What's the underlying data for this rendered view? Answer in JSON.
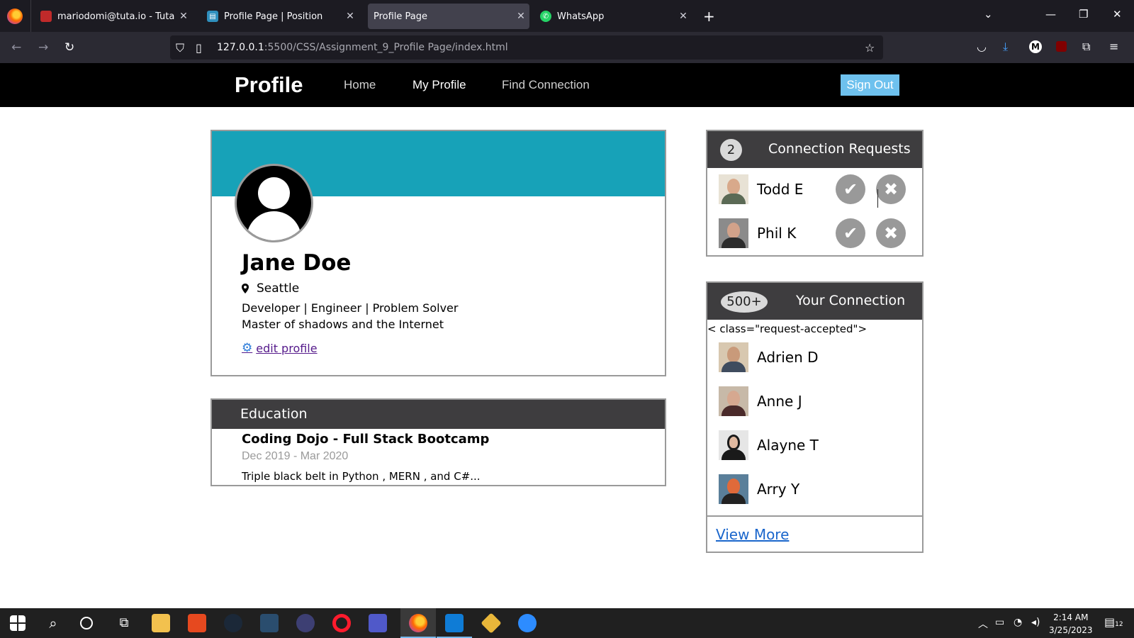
{
  "browser": {
    "tabs": [
      {
        "title": "mariodomi@tuta.io - Tutanota",
        "active": false
      },
      {
        "title": "Profile Page | Position",
        "active": false
      },
      {
        "title": "Profile Page",
        "active": true
      },
      {
        "title": "WhatsApp",
        "active": false
      }
    ],
    "url_host": "127.0.0.1",
    "url_rest": ":5500/CSS/Assignment_9_Profile Page/index.html",
    "new_tab": "+"
  },
  "site_nav": {
    "brand": "Profile",
    "links": [
      "Home",
      "My Profile",
      "Find Connection"
    ],
    "current": "My Profile",
    "sign_out": "Sign Out"
  },
  "profile": {
    "name": "Jane Doe",
    "location": "Seattle",
    "tagline": "Developer | Engineer | Problem Solver",
    "bio": "Master of shadows and the Internet",
    "edit_label": "edit profile"
  },
  "education": {
    "header": "Education",
    "school": "Coding Dojo - Full Stack Bootcamp",
    "dates": "Dec 2019 - Mar 2020",
    "description": "Triple black belt in Python , MERN , and C#..."
  },
  "requests": {
    "count": "2",
    "header": "Connection Requests",
    "people": [
      "Todd E",
      "Phil K"
    ]
  },
  "connections": {
    "count": "500+",
    "header": "Your Connection",
    "stray_text": "< class=\"request-accepted\">",
    "people": [
      "Adrien D",
      "Anne J",
      "Alayne T",
      "Arry Y"
    ],
    "view_more": "View More"
  },
  "taskbar": {
    "time": "2:14 AM",
    "date": "3/25/2023",
    "notification_count": "12"
  }
}
